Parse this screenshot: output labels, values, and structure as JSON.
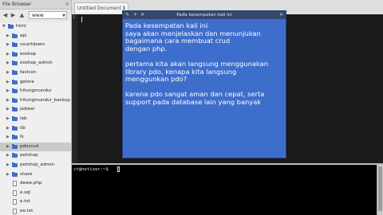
{
  "file_browser": {
    "title": "File Browser",
    "root_select": "www",
    "tree": [
      {
        "label": "html",
        "kind": "folder",
        "depth": 0,
        "expanded": true
      },
      {
        "label": "api",
        "kind": "folder",
        "depth": 1
      },
      {
        "label": "countdown",
        "kind": "folder",
        "depth": 1
      },
      {
        "label": "eoshop",
        "kind": "folder",
        "depth": 1
      },
      {
        "label": "eoshop_admin",
        "kind": "folder",
        "depth": 1
      },
      {
        "label": "favicon",
        "kind": "folder",
        "depth": 1
      },
      {
        "label": "gelora",
        "kind": "folder",
        "depth": 1
      },
      {
        "label": "hitungmundur",
        "kind": "folder",
        "depth": 1
      },
      {
        "label": "hitungmundur_backup",
        "kind": "folder",
        "depth": 1
      },
      {
        "label": "jadwal",
        "kind": "folder",
        "depth": 1
      },
      {
        "label": "lab",
        "kind": "folder",
        "depth": 1
      },
      {
        "label": "lib",
        "kind": "folder",
        "depth": 1
      },
      {
        "label": "lk",
        "kind": "folder",
        "depth": 1
      },
      {
        "label": "pdocrud",
        "kind": "folder",
        "depth": 1,
        "selected": true
      },
      {
        "label": "petshop",
        "kind": "folder",
        "depth": 1
      },
      {
        "label": "petshop_admin",
        "kind": "folder",
        "depth": 1
      },
      {
        "label": "share",
        "kind": "folder",
        "depth": 1
      },
      {
        "label": "dewe.php",
        "kind": "file",
        "depth": 1
      },
      {
        "label": "e.sql",
        "kind": "file",
        "depth": 1
      },
      {
        "label": "e.txt",
        "kind": "file",
        "depth": 1
      },
      {
        "label": "ee.txt",
        "kind": "file",
        "depth": 1
      }
    ]
  },
  "editor": {
    "tab_title": "Untitled Document 1",
    "line_number": "1"
  },
  "note": {
    "title": "Pada kesempatan kali ini",
    "paragraphs": [
      "Pada kesempatan kali ini\nsaya akan menjelaskan dan menunjukan\nbagaimana cara membuat crud\ndengan php.",
      "pertama kita akan langsung menggunakan\nlibrary pdo, kenapa kita langsung\nmenggunkan pdo?",
      "karena pdo sangat aman dan cepat, serta\nsupport pada database lain yang banyak"
    ]
  },
  "terminal": {
    "prompt": "ct@netizer:~$"
  },
  "colors": {
    "note_bg": "#3e6ecb",
    "note_title_bg": "#37476b",
    "folder": "#3b6fc7",
    "editor_bg": "#1a1a1a"
  }
}
